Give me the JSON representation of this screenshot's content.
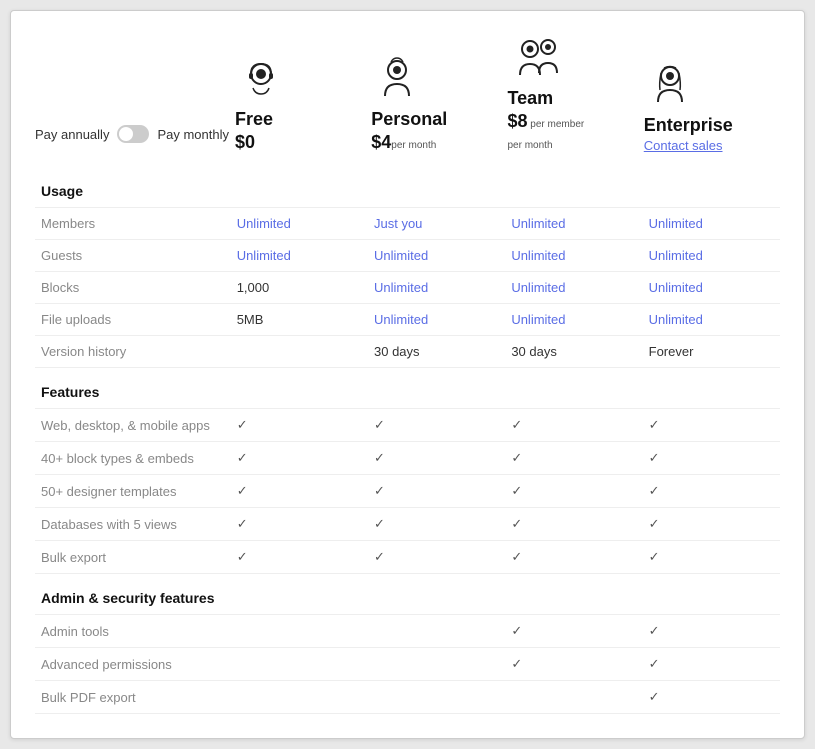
{
  "toggle": {
    "pay_annually": "Pay annually",
    "pay_monthly": "Pay monthly"
  },
  "plans": [
    {
      "id": "free",
      "name": "Free",
      "price": "$0",
      "price_sub": "",
      "contact_sales": null,
      "avatar": "free"
    },
    {
      "id": "personal",
      "name": "Personal",
      "price": "$4",
      "price_sub": "per month",
      "contact_sales": null,
      "avatar": "personal"
    },
    {
      "id": "team",
      "name": "Team",
      "price": "$8",
      "price_sub": "per member\nper month",
      "contact_sales": null,
      "avatar": "team"
    },
    {
      "id": "enterprise",
      "name": "Enterprise",
      "price": null,
      "price_sub": null,
      "contact_sales": "Contact sales",
      "avatar": "enterprise"
    }
  ],
  "sections": [
    {
      "id": "usage",
      "label": "Usage",
      "rows": [
        {
          "label": "Members",
          "values": [
            "Unlimited",
            "Just you",
            "Unlimited",
            "Unlimited"
          ],
          "types": [
            "unlimited",
            "plain",
            "plain",
            "plain"
          ]
        },
        {
          "label": "Guests",
          "values": [
            "Unlimited",
            "Unlimited",
            "Unlimited",
            "Unlimited"
          ],
          "types": [
            "unlimited",
            "unlimited",
            "plain",
            "plain"
          ]
        },
        {
          "label": "Blocks",
          "values": [
            "1,000",
            "Unlimited",
            "Unlimited",
            "Unlimited"
          ],
          "types": [
            "plain",
            "unlimited",
            "plain",
            "plain"
          ]
        },
        {
          "label": "File uploads",
          "values": [
            "5MB",
            "Unlimited",
            "Unlimited",
            "Unlimited"
          ],
          "types": [
            "plain",
            "unlimited",
            "plain",
            "plain"
          ]
        },
        {
          "label": "Version history",
          "values": [
            "",
            "30 days",
            "30 days",
            "Forever"
          ],
          "types": [
            "plain",
            "plain",
            "plain",
            "plain"
          ]
        }
      ]
    },
    {
      "id": "features",
      "label": "Features",
      "rows": [
        {
          "label": "Web, desktop, & mobile apps",
          "values": [
            "✓",
            "✓",
            "✓",
            "✓"
          ],
          "types": [
            "check",
            "check",
            "check",
            "check"
          ]
        },
        {
          "label": "40+ block types & embeds",
          "values": [
            "✓",
            "✓",
            "✓",
            "✓"
          ],
          "types": [
            "check",
            "check",
            "check",
            "check"
          ]
        },
        {
          "label": "50+ designer templates",
          "values": [
            "✓",
            "✓",
            "✓",
            "✓"
          ],
          "types": [
            "check",
            "check",
            "check",
            "check"
          ]
        },
        {
          "label": "Databases with 5 views",
          "values": [
            "✓",
            "✓",
            "✓",
            "✓"
          ],
          "types": [
            "check",
            "check",
            "check",
            "check"
          ]
        },
        {
          "label": "Bulk export",
          "values": [
            "✓",
            "✓",
            "✓",
            "✓"
          ],
          "types": [
            "check",
            "check",
            "check",
            "check"
          ]
        }
      ]
    },
    {
      "id": "admin",
      "label": "Admin & security features",
      "rows": [
        {
          "label": "Admin tools",
          "values": [
            "",
            "",
            "✓",
            "✓"
          ],
          "types": [
            "plain",
            "plain",
            "check",
            "check"
          ]
        },
        {
          "label": "Advanced permissions",
          "values": [
            "",
            "",
            "✓",
            "✓"
          ],
          "types": [
            "plain",
            "plain",
            "check",
            "check"
          ]
        },
        {
          "label": "Bulk PDF export",
          "values": [
            "",
            "",
            "",
            "✓"
          ],
          "types": [
            "plain",
            "plain",
            "plain",
            "check"
          ]
        }
      ]
    }
  ]
}
